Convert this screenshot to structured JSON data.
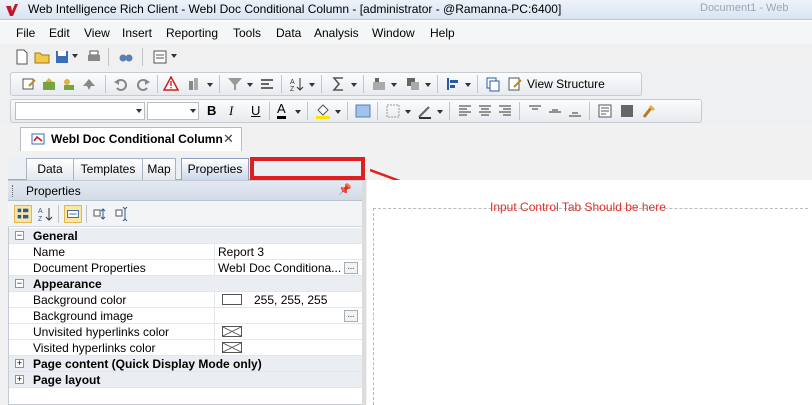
{
  "window": {
    "title": "Web Intelligence Rich Client - WebI Doc Conditional Column - [administrator - @Ramanna-PC:6400]",
    "faded_text": "Document1 - Web"
  },
  "menu": [
    "File",
    "Edit",
    "View",
    "Insert",
    "Reporting",
    "Tools",
    "Data",
    "Analysis",
    "Window",
    "Help"
  ],
  "toolbar": {
    "view_structure_label": "View Structure"
  },
  "doc_tab": {
    "label": "WebI Doc Conditional Column",
    "close": "✕"
  },
  "left_tabs": [
    "Data",
    "Templates",
    "Map",
    "Properties"
  ],
  "callout": {
    "text": "Input Control Tab Should be here"
  },
  "properties": {
    "title": "Properties",
    "pin": "📌",
    "rows": [
      {
        "type": "group",
        "name": "General"
      },
      {
        "type": "prop",
        "name": "Name",
        "value": "Report 3"
      },
      {
        "type": "prop",
        "name": "Document Properties",
        "value": "WebI Doc Conditiona...",
        "ellipsis": true
      },
      {
        "type": "group",
        "name": "Appearance"
      },
      {
        "type": "prop",
        "name": "Background color",
        "value": "255, 255, 255",
        "swatch": true
      },
      {
        "type": "prop",
        "name": "Background image",
        "value": "",
        "ellipsis": true
      },
      {
        "type": "prop",
        "name": "Unvisited hyperlinks color",
        "value": "",
        "xbox": true
      },
      {
        "type": "prop",
        "name": "Visited hyperlinks color",
        "value": "",
        "xbox": true
      },
      {
        "type": "collapsed",
        "name": "Page content (Quick Display Mode only)"
      },
      {
        "type": "collapsed",
        "name": "Page layout"
      }
    ]
  },
  "colors": {
    "accent_red": "#e02020",
    "callout_text": "#e0302a"
  }
}
